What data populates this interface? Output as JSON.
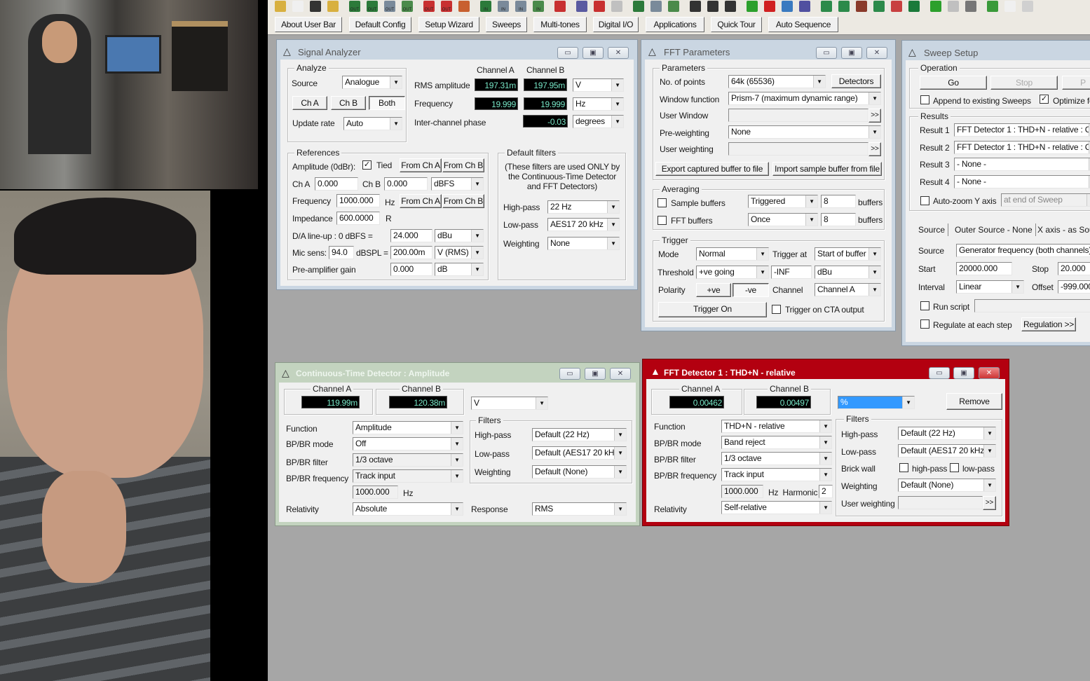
{
  "toolbar": {
    "icons": [
      {
        "name": "open-folder-icon",
        "color": "#d8b040"
      },
      {
        "name": "dropdown-icon",
        "color": "#f0f0f0"
      },
      {
        "name": "save-icon",
        "color": "#333"
      },
      {
        "name": "save-as-icon",
        "color": "#d8b040"
      },
      {
        "name": "generator-out-1-icon",
        "color": "#2c7a3a",
        "tag": "OUT"
      },
      {
        "name": "generator-out-2-icon",
        "color": "#2c7a3a",
        "tag": "OUT"
      },
      {
        "name": "generator-out-3-icon",
        "color": "#7a8a9a",
        "tag": "OUT"
      },
      {
        "name": "generator-out-4-icon",
        "color": "#4a8a4a",
        "tag": "OUT"
      },
      {
        "name": "generator-off-1-icon",
        "color": "#c83030",
        "tag": "OUT"
      },
      {
        "name": "generator-off-2-icon",
        "color": "#c83030",
        "tag": "OUT"
      },
      {
        "name": "generator-off-3-icon",
        "color": "#c86030"
      },
      {
        "name": "analyzer-in-1-icon",
        "color": "#2c7a3a",
        "tag": "IN"
      },
      {
        "name": "analyzer-in-2-icon",
        "color": "#7a8a9a",
        "tag": "IN"
      },
      {
        "name": "analyzer-in-3-icon",
        "color": "#7a8a9a",
        "tag": "IN"
      },
      {
        "name": "analyzer-in-4-icon",
        "color": "#4a8a4a",
        "tag": "IN"
      },
      {
        "name": "stop-all-icon",
        "color": "#c83030"
      },
      {
        "name": "waveform-icon",
        "color": "#5a5aa0"
      },
      {
        "name": "waveform-off-icon",
        "color": "#c83030"
      },
      {
        "name": "waveform-disabled-icon",
        "color": "#c0c0c0"
      },
      {
        "name": "channel-1-icon",
        "color": "#2c7a3a"
      },
      {
        "name": "channel-2-icon",
        "color": "#7a8a9a"
      },
      {
        "name": "channel-3-icon",
        "color": "#4a8a4a"
      },
      {
        "name": "channel-ab-1-icon",
        "color": "#333"
      },
      {
        "name": "channel-ab-2-icon",
        "color": "#333"
      },
      {
        "name": "channel-ab-3-icon",
        "color": "#333"
      },
      {
        "name": "go-green-icon",
        "color": "#2ca02c"
      },
      {
        "name": "record-red-icon",
        "color": "#d02020"
      },
      {
        "name": "sweep-icon",
        "color": "#3a7ac0"
      },
      {
        "name": "sweep-settings-icon",
        "color": "#5050a0"
      },
      {
        "name": "graph-1-icon",
        "color": "#2c8a4a"
      },
      {
        "name": "graph-2-icon",
        "color": "#2c8a4a"
      },
      {
        "name": "graph-3-icon",
        "color": "#8a3a2a"
      },
      {
        "name": "graph-4-icon",
        "color": "#2c8a4a"
      },
      {
        "name": "graph-5-icon",
        "color": "#c84040"
      },
      {
        "name": "graph-6-icon",
        "color": "#1a7a3a"
      },
      {
        "name": "script-run-icon",
        "color": "#2ca02c"
      },
      {
        "name": "script-disabled-icon",
        "color": "#c0c0c0"
      },
      {
        "name": "calculator-icon",
        "color": "#777"
      },
      {
        "name": "export-icon",
        "color": "#3a9a3a"
      },
      {
        "name": "dropdown-2-icon",
        "color": "#f0f0f0"
      },
      {
        "name": "disabled-icon",
        "color": "#d0d0d0"
      }
    ],
    "buttons": [
      "About User Bar",
      "Default Config",
      "Setup Wizard",
      "Sweeps",
      "Multi-tones",
      "Digital I/O",
      "Applications",
      "Quick Tour",
      "Auto Sequence"
    ]
  },
  "signal_analyzer": {
    "title": "Signal Analyzer",
    "analyze": {
      "legend": "Analyze",
      "source_label": "Source",
      "source": "Analogue",
      "ch_a": "Ch A",
      "ch_b": "Ch B",
      "both": "Both",
      "update_label": "Update rate",
      "update": "Auto"
    },
    "channel_a": "Channel A",
    "channel_b": "Channel B",
    "rms_label": "RMS amplitude",
    "rms_a": "197.31m",
    "rms_b": "197.95m",
    "rms_unit": "V",
    "freq_label": "Frequency",
    "freq_a": "19.999",
    "freq_b": "19.999",
    "freq_unit": "Hz",
    "phase_label": "Inter-channel phase",
    "phase": "-0.03",
    "phase_unit": "degrees",
    "refs": {
      "legend": "References",
      "amp_label": "Amplitude (0dBr):",
      "tied": "Tied",
      "from_a": "From Ch A",
      "from_b": "From Ch B",
      "cha_label": "Ch A",
      "cha": "0.000",
      "chb_label": "Ch B",
      "chb": "0.000",
      "amp_unit": "dBFS",
      "freq_label": "Frequency",
      "freq": "1000.000",
      "hz": "Hz",
      "imp_label": "Impedance",
      "imp": "600.0000",
      "r": "R",
      "da_label": "D/A line-up : 0 dBFS =",
      "da": "24.000",
      "da_unit": "dBu",
      "mic_label": "Mic sens:",
      "mic": "94.0",
      "dbspl": "dBSPL =",
      "mic_v": "200.00m",
      "mic_unit": "V (RMS)",
      "pre_label": "Pre-amplifier gain",
      "pre": "0.000",
      "pre_unit": "dB"
    },
    "filters": {
      "legend": "Default filters",
      "note1": "(These filters are used ONLY by",
      "note2": "the Continuous-Time Detector",
      "note3": "and FFT Detectors)",
      "hp_label": "High-pass",
      "hp": "22 Hz",
      "lp_label": "Low-pass",
      "lp": "AES17 20 kHz",
      "w_label": "Weighting",
      "w": "None"
    }
  },
  "fft_parameters": {
    "title": "FFT Parameters",
    "params": {
      "legend": "Parameters",
      "points_label": "No. of points",
      "points": "64k (65536)",
      "detectors": "Detectors",
      "window_label": "Window function",
      "window": "Prism-7 (maximum dynamic range)",
      "user_window_label": "User Window",
      "preweight_label": "Pre-weighting",
      "preweight": "None",
      "user_weight_label": "User weighting",
      "more": ">>",
      "export": "Export captured buffer to file",
      "import": "Import sample buffer from file"
    },
    "averaging": {
      "legend": "Averaging",
      "sample_label": "Sample buffers",
      "sample_mode": "Triggered",
      "sample_n": "8",
      "fft_label": "FFT buffers",
      "fft_mode": "Once",
      "fft_n": "8",
      "buffers": "buffers"
    },
    "trigger": {
      "legend": "Trigger",
      "mode_label": "Mode",
      "mode": "Normal",
      "at_label": "Trigger at",
      "at": "Start of buffer",
      "thr_label": "Threshold",
      "thr": "+ve going",
      "thr_val": "-INF",
      "thr_unit": "dBu",
      "pol_label": "Polarity",
      "pos": "+ve",
      "neg": "-ve",
      "ch_label": "Channel",
      "ch": "Channel A",
      "trigger_on": "Trigger On",
      "cta": "Trigger on CTA output"
    }
  },
  "sweep_setup": {
    "title": "Sweep Setup",
    "op_legend": "Operation",
    "go": "Go",
    "stop": "Stop",
    "pause": "P",
    "append": "Append to existing Sweeps",
    "optimize": "Optimize fo",
    "results_legend": "Results",
    "results": [
      {
        "label": "Result 1",
        "value": "FFT Detector 1 : THD+N - relative : C"
      },
      {
        "label": "Result 2",
        "value": "FFT Detector 1 : THD+N - relative : C"
      },
      {
        "label": "Result 3",
        "value": "- None -"
      },
      {
        "label": "Result 4",
        "value": "- None -"
      }
    ],
    "autozoom": "Auto-zoom Y axis",
    "autozoom_when": "at end of Sweep",
    "tabs": [
      "Source",
      "Outer Source - None",
      "X axis - as Sou"
    ],
    "source_label": "Source",
    "source": "Generator frequency (both channels)",
    "start_label": "Start",
    "start": "20000.000",
    "stop_label": "Stop",
    "stop_val": "20.000",
    "interval_label": "Interval",
    "interval": "Linear",
    "offset_label": "Offset",
    "offset": "-999.000",
    "run_script": "Run script",
    "regulate": "Regulate at each step",
    "regulation": "Regulation >>"
  },
  "ct_detector": {
    "title": "Continuous-Time Detector : Amplitude",
    "channel_a": "Channel A",
    "value_a": "119.99m",
    "channel_b": "Channel B",
    "value_b": "120.38m",
    "unit": "V",
    "function_label": "Function",
    "function": "Amplitude",
    "mode_label": "BP/BR mode",
    "mode": "Off",
    "filter_label": "BP/BR filter",
    "filter": "1/3 octave",
    "freq_label": "BP/BR frequency",
    "freq": "Track input",
    "freq_val": "1000.000",
    "hz": "Hz",
    "rel_label": "Relativity",
    "rel": "Absolute",
    "filters_legend": "Filters",
    "hp_label": "High-pass",
    "hp": "Default (22 Hz)",
    "lp_label": "Low-pass",
    "lp": "Default (AES17 20 kH",
    "w_label": "Weighting",
    "w": "Default (None)",
    "resp_label": "Response",
    "resp": "RMS"
  },
  "fft_detector": {
    "title": "FFT Detector 1 : THD+N - relative",
    "channel_a": "Channel A",
    "value_a": "0.00462",
    "channel_b": "Channel B",
    "value_b": "0.00497",
    "unit": "%",
    "remove": "Remove",
    "function_label": "Function",
    "function": "THD+N - relative",
    "mode_label": "BP/BR mode",
    "mode": "Band reject",
    "filter_label": "BP/BR filter",
    "filter": "1/3 octave",
    "freq_label": "BP/BR frequency",
    "freq": "Track input",
    "freq_val": "1000.000",
    "hz_harm": "Hz  Harmonic",
    "harmonic": "2",
    "rel_label": "Relativity",
    "rel": "Self-relative",
    "filters_legend": "Filters",
    "hp_label": "High-pass",
    "hp": "Default (22 Hz)",
    "lp_label": "Low-pass",
    "lp": "Default (AES17 20 kHz",
    "brick_label": "Brick wall",
    "brick_hp": "high-pass",
    "brick_lp": "low-pass",
    "w_label": "Weighting",
    "w": "Default (None)",
    "uw_label": "User weighting",
    "more": ">>"
  },
  "colors": {
    "lcd_text": "#77e6c6",
    "active_window": "#b30010",
    "ct_window": "#c3d3bf",
    "inactive_window": "#cad6e2",
    "selection": "#3399ff"
  }
}
